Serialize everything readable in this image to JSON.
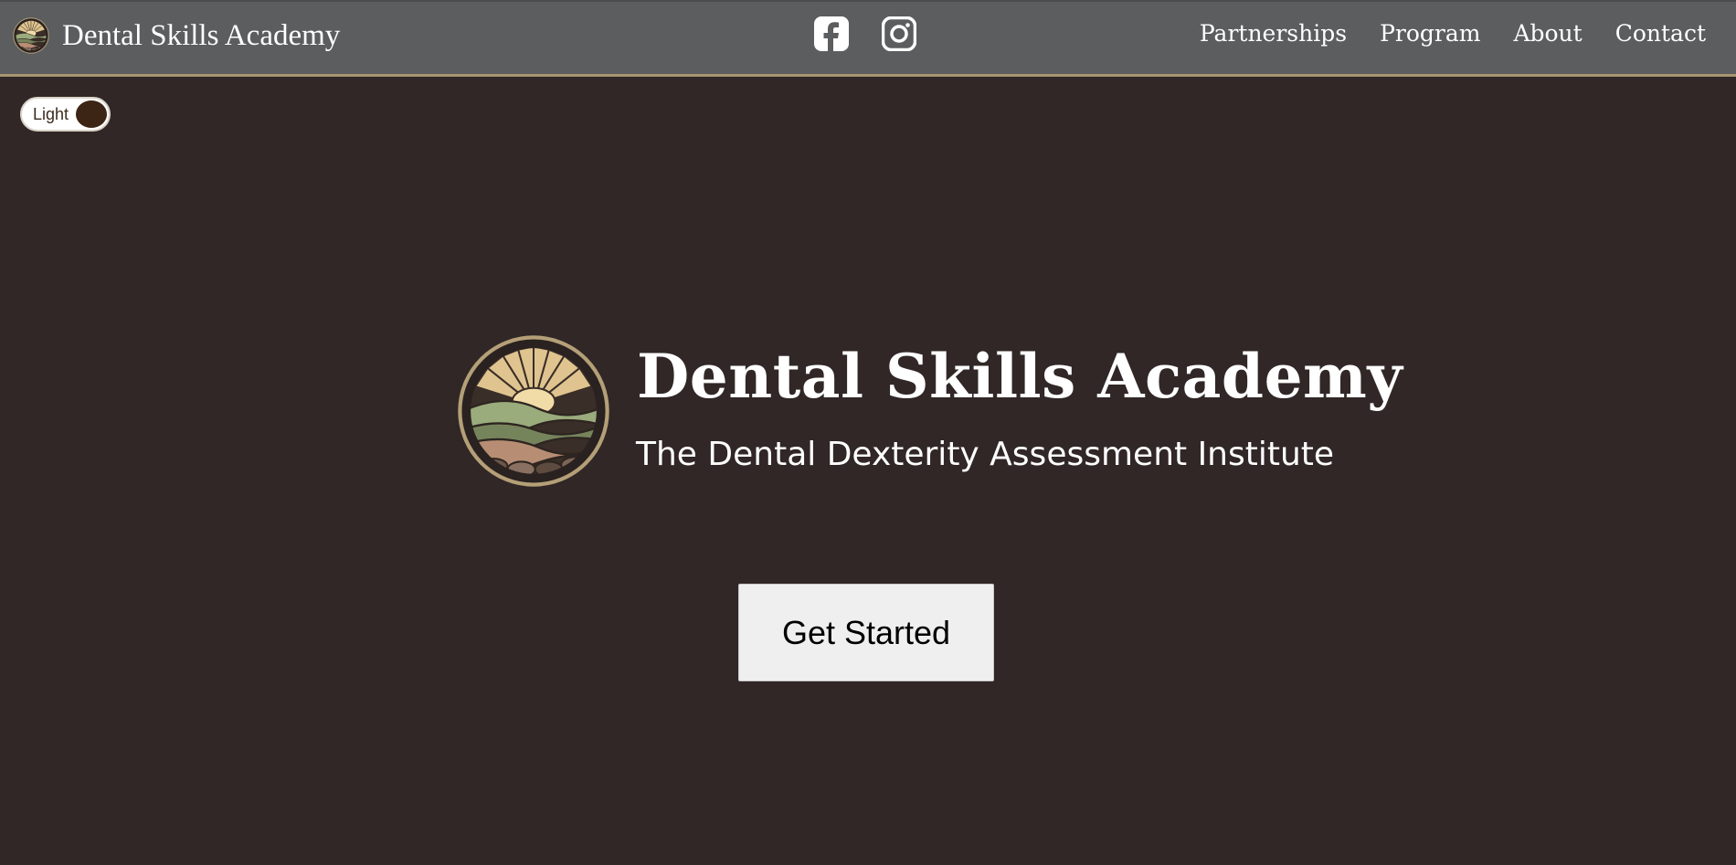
{
  "header": {
    "brand_name": "Dental Skills Academy",
    "brand_logo_icon": "academy-logo-icon",
    "social": [
      {
        "name": "facebook",
        "icon": "facebook-icon"
      },
      {
        "name": "instagram",
        "icon": "instagram-icon"
      }
    ],
    "nav": [
      "Partnerships",
      "Program",
      "About",
      "Contact"
    ]
  },
  "theme_toggle": {
    "label": "Light"
  },
  "hero": {
    "logo_icon": "academy-logo-icon",
    "title": "Dental Skills Academy",
    "subtitle": "The Dental Dexterity Assessment Institute",
    "cta_label": "Get Started"
  },
  "colors": {
    "page_background": "#302726",
    "header_background": "#5b5d5f",
    "header_border_accent": "#a89672",
    "text": "#ffffff",
    "button_background": "#efefef",
    "toggle_knob": "#3d2516"
  }
}
